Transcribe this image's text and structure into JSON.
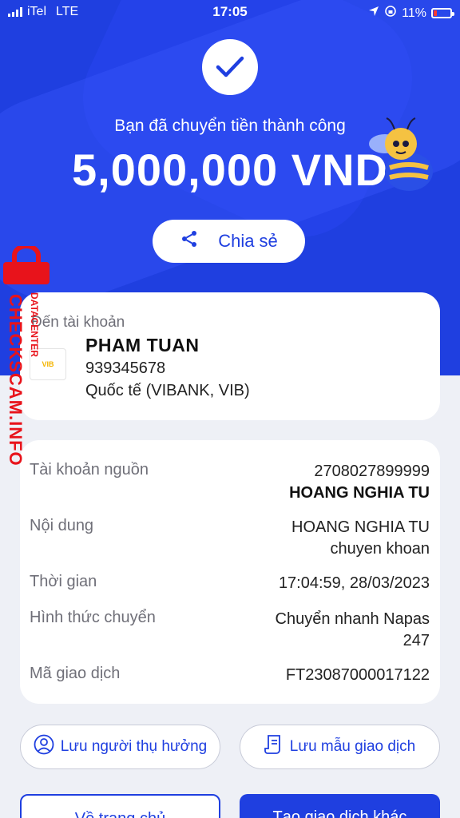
{
  "status_bar": {
    "carrier": "iTel",
    "network": "LTE",
    "time": "17:05",
    "battery": "11%"
  },
  "hero": {
    "success_message": "Bạn đã chuyển tiền thành công",
    "amount": "5,000,000 VND",
    "share_label": "Chia sẻ"
  },
  "watermark": {
    "main": "CHECKSCAM.INFO",
    "sub": "DATACENTER"
  },
  "destination": {
    "label": "Đến tài khoản",
    "bank_logo": "VIB",
    "name": "PHAM TUAN",
    "account": "939345678",
    "bank": "Quốc tế (VIBANK, VIB)"
  },
  "details": [
    {
      "label": "Tài khoản nguồn",
      "value": "2708027899999",
      "value2": "HOANG NGHIA TU"
    },
    {
      "label": "Nội dung",
      "value": "HOANG NGHIA TU",
      "value2": "chuyen khoan"
    },
    {
      "label": "Thời gian",
      "value": "17:04:59, 28/03/2023"
    },
    {
      "label": "Hình thức chuyển",
      "value": "Chuyển nhanh Napas",
      "value2": "247"
    },
    {
      "label": "Mã giao dịch",
      "value": "FT23087000017122"
    }
  ],
  "actions": {
    "save_beneficiary": "Lưu người thụ hưởng",
    "save_template": "Lưu mẫu giao dịch",
    "home": "Về trang chủ",
    "new_transaction": "Tạo giao dịch khác"
  },
  "colors": {
    "primary": "#1f3fe0",
    "watermark": "#e8131b",
    "background": "#eef0f6"
  }
}
